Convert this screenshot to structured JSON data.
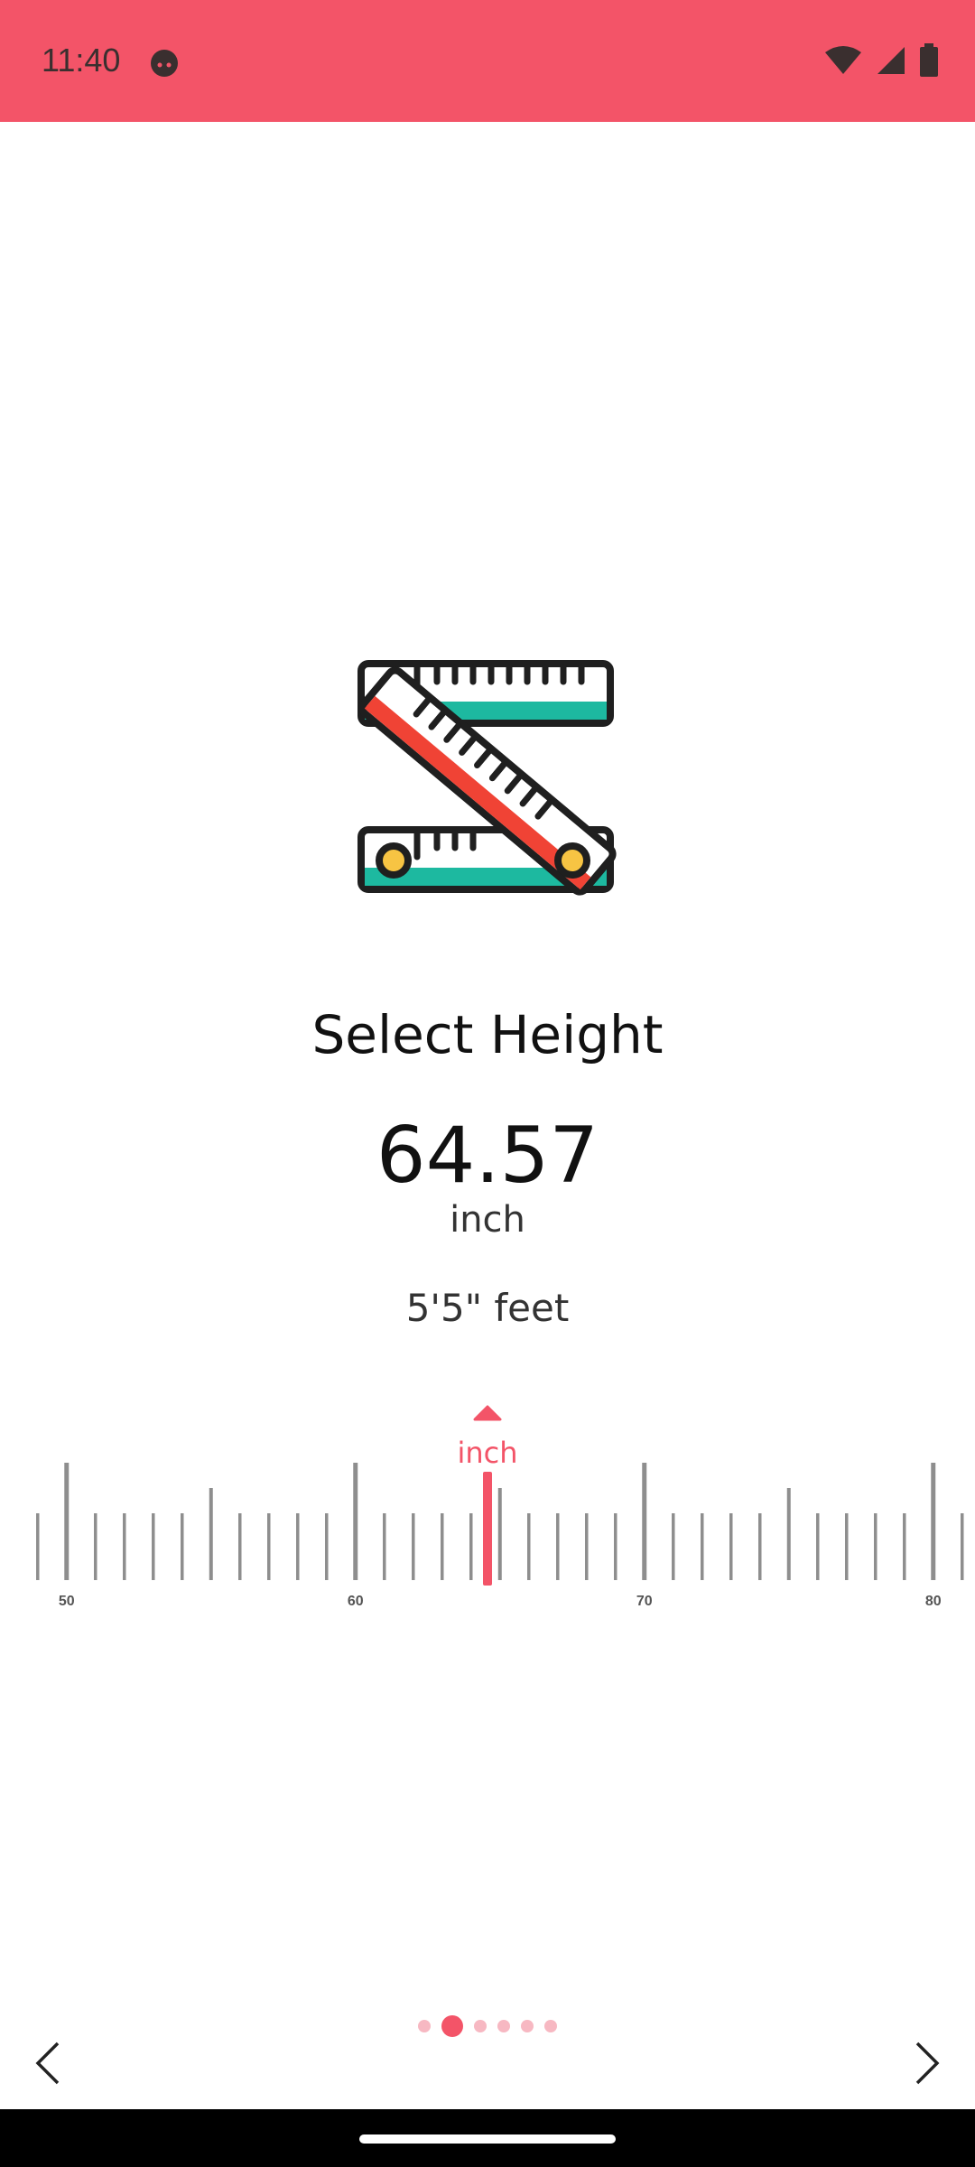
{
  "status_bar": {
    "time": "11:40",
    "icons": [
      "notification-face-icon",
      "wifi-icon",
      "cellular-signal-icon",
      "battery-icon"
    ]
  },
  "screen": {
    "illustration": "folding-ruler-icon",
    "title": "Select Height",
    "value": "64.57",
    "unit": "inch",
    "feet_text": "5'5\" feet"
  },
  "ruler": {
    "unit_label": "inch",
    "min": 49,
    "max": 82,
    "selected": 64.57,
    "major_labels": [
      "50",
      "60",
      "70",
      "80"
    ],
    "accent": "#F35468",
    "tick_color": "#8E8E8E"
  },
  "pager": {
    "total": 6,
    "current": 2
  },
  "nav": {
    "prev": "chevron-left-icon",
    "next": "chevron-right-icon"
  },
  "colors": {
    "accent": "#F35468",
    "teal": "#1DB9A0",
    "red": "#F04335",
    "yellow": "#F7C443"
  }
}
